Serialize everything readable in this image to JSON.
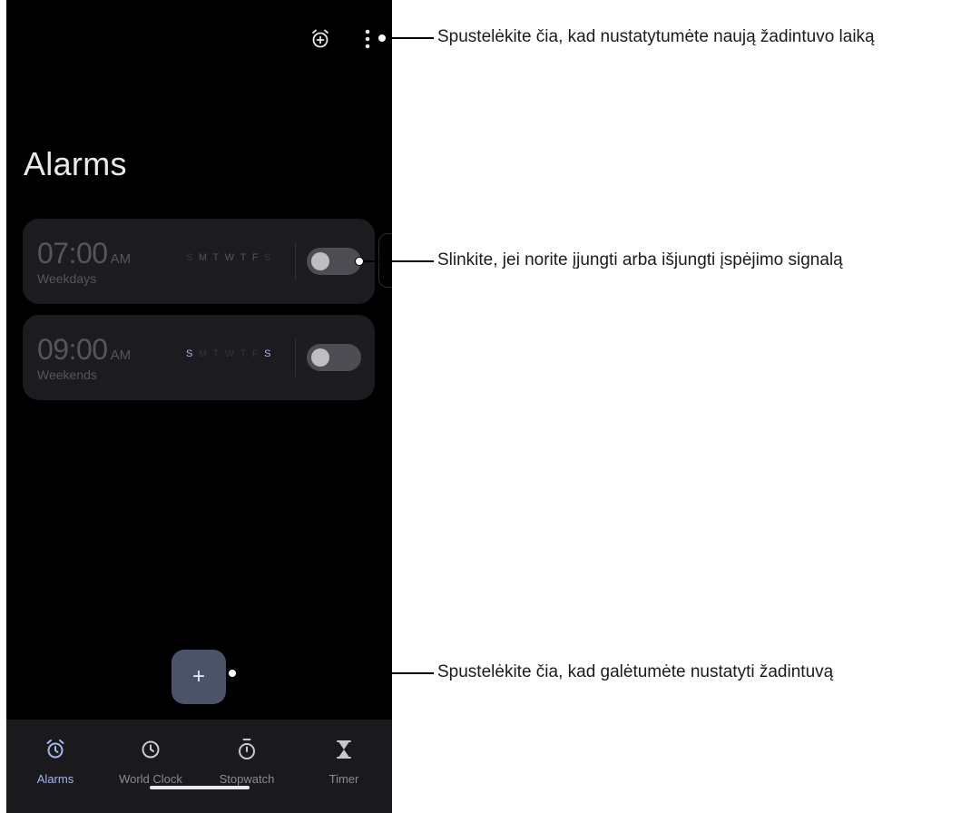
{
  "header": {
    "add_alarm_icon": "alarm-add-icon",
    "more_icon": "more-vertical-icon"
  },
  "page_title": "Alarms",
  "alarms": [
    {
      "time": "07:00",
      "ampm": "AM",
      "repeat_label": "Weekdays",
      "days": [
        "S",
        "M",
        "T",
        "W",
        "T",
        "F",
        "S"
      ],
      "active_days": [
        false,
        true,
        true,
        true,
        true,
        true,
        false
      ],
      "enabled": false
    },
    {
      "time": "09:00",
      "ampm": "AM",
      "repeat_label": "Weekends",
      "days": [
        "S",
        "M",
        "T",
        "W",
        "T",
        "F",
        "S"
      ],
      "active_days": [
        true,
        false,
        false,
        false,
        false,
        false,
        true
      ],
      "enabled": false
    }
  ],
  "fab": {
    "label": "+"
  },
  "bottom_nav": [
    {
      "label": "Alarms",
      "icon": "alarm-clock-icon",
      "active": true
    },
    {
      "label": "World Clock",
      "icon": "clock-icon",
      "active": false
    },
    {
      "label": "Stopwatch",
      "icon": "stopwatch-icon",
      "active": false
    },
    {
      "label": "Timer",
      "icon": "hourglass-icon",
      "active": false
    }
  ],
  "callouts": [
    "Spustelėkite čia, kad nustatytumėte naują žadintuvo laiką",
    "Slinkite, jei norite įjungti arba išjungti įspėjimo signalą",
    "Spustelėkite čia, kad galėtumėte nustatyti žadintuvą"
  ],
  "colors": {
    "accent": "#a7b6ee",
    "background": "#000000",
    "card": "#1c1c20",
    "fab": "#4b5368",
    "nav": "#1a1a1d"
  }
}
